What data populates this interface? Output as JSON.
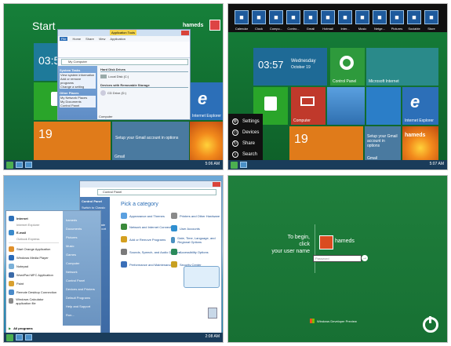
{
  "panel1": {
    "start_title": "Start",
    "user_name": "hameds",
    "clock_time": "03:57",
    "tiles": {
      "calendar_number": "19",
      "gmail_message": "Setup your Gmail account in options",
      "gmail_label": "Gmail",
      "ie_label": "Internet Explorer"
    },
    "explorer": {
      "ribbon_tabs": [
        "File",
        "Home",
        "Share",
        "View"
      ],
      "ribbon_context_tab": "Application Tools",
      "ribbon_sub_tab": "Application",
      "address": "My Computer",
      "sidebar_sections": [
        {
          "heading": "System Tasks",
          "items": [
            "View system information",
            "Add or remove programs",
            "Change a setting"
          ]
        },
        {
          "heading": "Other Places",
          "items": [
            "My Network Places",
            "My Documents",
            "Control Panel"
          ]
        }
      ],
      "drive_groups": [
        {
          "heading": "Hard Disk Drives",
          "items": [
            "Local Disk (C:)"
          ]
        },
        {
          "heading": "Devices with Removable Storage",
          "items": [
            "CD Drive (D:)"
          ]
        }
      ],
      "status": "Computer"
    },
    "taskbar_time": "5:06 AM"
  },
  "panel2": {
    "user_name": "hameds",
    "app_bar": [
      {
        "label": "Calendar",
        "icon": "calendar-icon"
      },
      {
        "label": "Clock",
        "icon": "clock-icon"
      },
      {
        "label": "Compu...",
        "icon": "computer-icon"
      },
      {
        "label": "Contro...",
        "icon": "control-panel-icon"
      },
      {
        "label": "Gmail",
        "icon": "gmail-icon"
      },
      {
        "label": "Hotmail",
        "icon": "hotmail-icon"
      },
      {
        "label": "Inter...",
        "icon": "ie-icon"
      },
      {
        "label": "Music",
        "icon": "music-icon"
      },
      {
        "label": "Netge...",
        "icon": "network-icon"
      },
      {
        "label": "Pictures",
        "icon": "pictures-icon"
      },
      {
        "label": "Sociable",
        "icon": "sociable-icon"
      },
      {
        "label": "Store",
        "icon": "store-icon"
      }
    ],
    "clock_time": "03:57",
    "clock_day": "Wednesday",
    "clock_date": "October 19",
    "tiles": {
      "control_panel_label": "Control Panel",
      "microsoft_label": "Microsoft Internet",
      "computer_label": "Computer",
      "calendar_number": "19",
      "gmail_message": "Setup your Gmail account in options",
      "gmail_label": "Gmail",
      "ie_label": "Internet Explorer",
      "user_tile_name": "hameds"
    },
    "charms": [
      "Settings",
      "Devices",
      "Share",
      "Search"
    ],
    "taskbar_time": "5:07 AM"
  },
  "panel3": {
    "start_menu": {
      "pinned": [
        {
          "label": "Internet",
          "sub": "Internet Explorer"
        },
        {
          "label": "E-mail",
          "sub": "Outlook Express"
        }
      ],
      "recent": [
        "Start Orange Application",
        "Windows Media Player",
        "Notepad",
        "WordPad MFC Application",
        "Paint",
        "Remote Desktop Connection",
        "Windows Calculator application file"
      ],
      "all_programs": "All programs",
      "right_items": [
        "hameds",
        "Documents",
        "Pictures",
        "Music",
        "Games",
        "Computer",
        "Network",
        "Control Panel",
        "Devices and Printers",
        "Default Programs",
        "Help and Support",
        "Run..."
      ]
    },
    "control_panel": {
      "address": "Control Panel",
      "heading": "Pick a category",
      "side_heading": "Control Panel",
      "side_link": "Switch to Classic View",
      "see_also": "See Also",
      "see_also_items": [
        "Windows Update",
        "Help and Support"
      ],
      "categories": [
        "Appearance and Themes",
        "Network and Internet Connections",
        "Add or Remove Programs",
        "Sounds, Speech, and Audio Devices",
        "Performance and Maintenance",
        "Printers and Other Hardware",
        "User Accounts",
        "Date, Time, Language, and Regional Options",
        "Accessibility Options",
        "Security Center"
      ]
    },
    "recycle_bin": "Recycle Bin",
    "taskbar_time": "2:08 AM"
  },
  "panel4": {
    "prompt_line1": "To begin,",
    "prompt_line2": "click",
    "prompt_line3": "your user name",
    "user_name": "hameds",
    "password_placeholder": "Password",
    "branding": "Windows Developer Preview"
  },
  "colors": {
    "start_green": "#0f6b2e",
    "login_green": "#1e7a3a",
    "tile_orange": "#e07b1a",
    "tile_teal": "#2a9d8f",
    "tile_blue": "#2c6fb8",
    "tile_red": "#c0392b",
    "desktop_blue": "#2c7fb3"
  }
}
